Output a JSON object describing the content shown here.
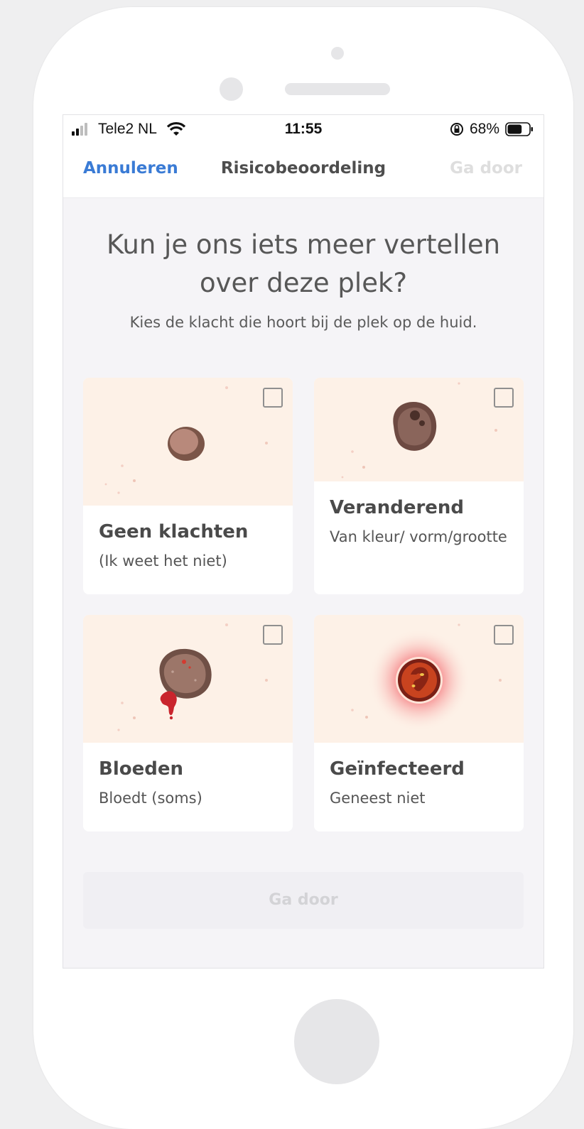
{
  "status_bar": {
    "carrier": "Tele2 NL",
    "time": "11:55",
    "battery_percent": "68%",
    "battery_level": 0.68,
    "signal_bars": 2
  },
  "nav": {
    "cancel_label": "Annuleren",
    "title": "Risicobeoordeling",
    "next_label": "Ga door"
  },
  "main": {
    "heading": "Kun je ons iets meer vertellen over deze plek?",
    "subheading": "Kies de klacht die hoort bij de plek op de huid.",
    "options": [
      {
        "title": "Geen klachten",
        "subtitle": "(Ik weet het niet)",
        "checked": false
      },
      {
        "title": "Veranderend",
        "subtitle": "Van kleur/ vorm/grootte",
        "checked": false
      },
      {
        "title": "Bloeden",
        "subtitle": "Bloedt (soms)",
        "checked": false
      },
      {
        "title": "Geïnfecteerd",
        "subtitle": "Geneest niet",
        "checked": false
      }
    ],
    "continue_label": "Ga door"
  },
  "colors": {
    "accent": "#3a7bd5",
    "disabled_text": "#d3d3d6",
    "skin_background": "#fdf1e7",
    "infection_red": "#e03a24"
  }
}
